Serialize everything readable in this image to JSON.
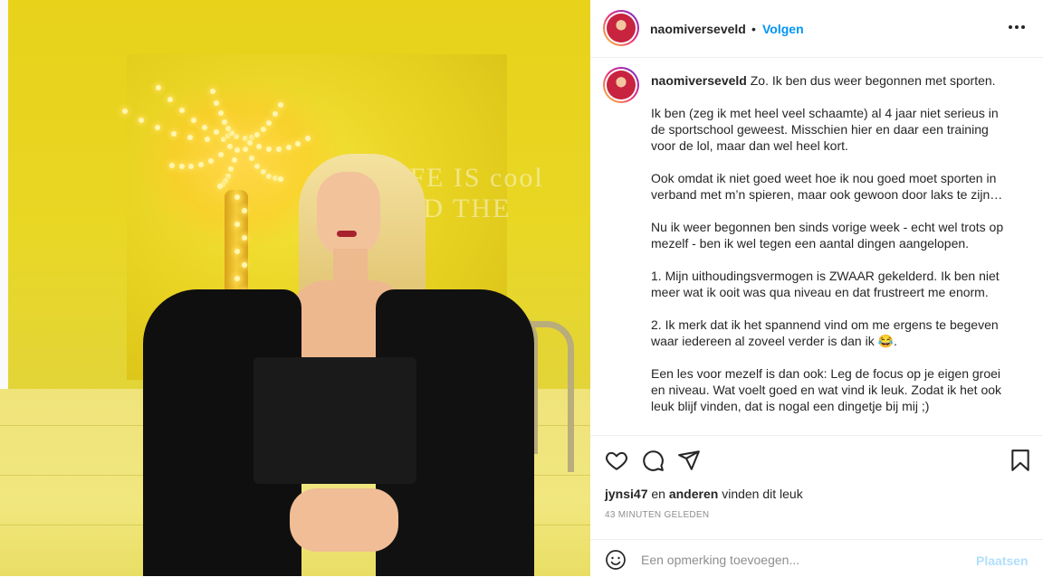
{
  "post": {
    "username": "naomiverseveld",
    "separator": "•",
    "follow_label": "Volgen",
    "more_icon": "more-horizontal-icon",
    "image_alt_text": "LIFE IS cool AND THE",
    "caption": {
      "username": "naomiverseveld",
      "first_line": "Zo. Ik ben dus weer begonnen met sporten.",
      "paragraphs": [
        "Ik ben (zeg ik met heel veel schaamte) al 4 jaar niet serieus in de sportschool geweest. Misschien hier en daar een training voor de lol, maar dan wel heel kort.",
        "Ook omdat ik niet goed weet hoe ik nou goed moet sporten in verband met m’n spieren, maar ook gewoon door laks te zijn…",
        "Nu ik weer begonnen ben sinds vorige week - echt wel trots op mezelf - ben ik wel tegen een aantal dingen aangelopen.",
        "1. Mijn uithoudingsvermogen is ZWAAR gekelderd. Ik ben niet meer wat ik ooit was qua niveau en dat frustreert me enorm.",
        "2. Ik merk dat ik het spannend vind om me ergens te begeven waar iedereen al zoveel verder is dan ik 😂.",
        "Een les voor mezelf is dan ook: Leg de focus op je eigen groei en niveau. Wat voelt goed en wat vind ik leuk. Zodat ik het ook leuk blijf vinden, dat is nogal een dingetje bij mij ;)"
      ]
    },
    "actions": {
      "like_icon": "heart-icon",
      "comment_icon": "comment-icon",
      "share_icon": "paper-plane-icon",
      "save_icon": "bookmark-icon"
    },
    "likes": {
      "user": "jynsi47",
      "conjunction": "en",
      "others": "anderen",
      "suffix": "vinden dit leuk"
    },
    "timestamp": "43 MINUTEN GELEDEN",
    "comment": {
      "placeholder": "Een opmerking toevoegen...",
      "submit_label": "Plaatsen",
      "emoji_icon": "smiley-icon"
    }
  },
  "colors": {
    "link_blue": "#0095f6",
    "disabled_blue": "#b2dffc",
    "text": "#262626",
    "muted": "#8e8e8e",
    "photo_yellow": "#e8d21a"
  }
}
